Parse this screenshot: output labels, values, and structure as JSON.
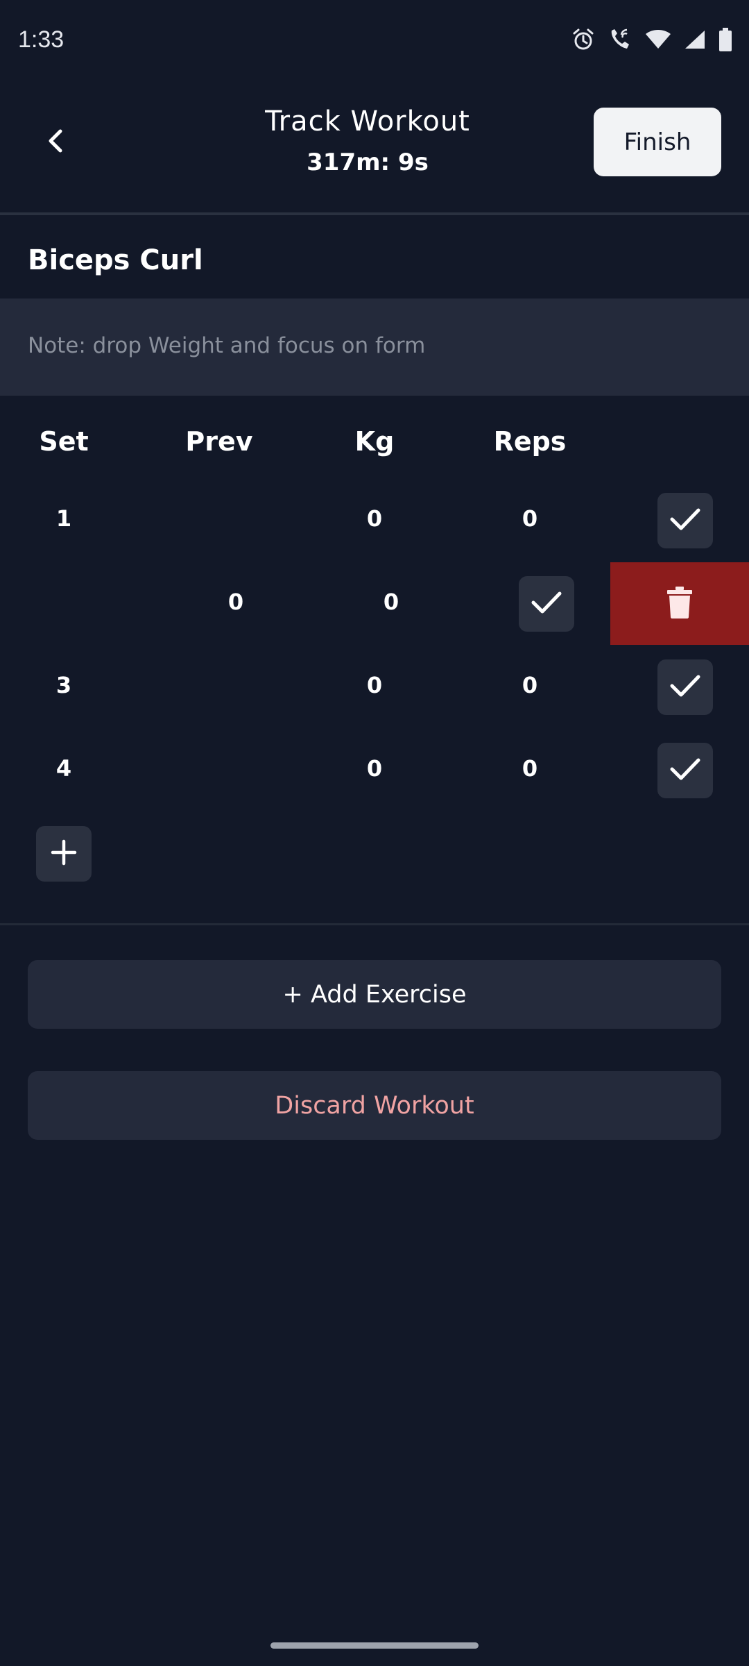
{
  "status_bar": {
    "time": "1:33",
    "icons": [
      "alarm-icon",
      "wifi-call-icon",
      "wifi-icon",
      "signal-icon",
      "battery-icon"
    ]
  },
  "header": {
    "back_icon": "chevron-left-icon",
    "title": "Track Workout",
    "timer": "317m: 9s",
    "finish_label": "Finish"
  },
  "exercise": {
    "name": "Biceps Curl",
    "note": "Note: drop Weight and focus on form"
  },
  "table": {
    "headers": [
      "Set",
      "Prev",
      "Kg",
      "Reps"
    ],
    "rows": [
      {
        "set": "1",
        "prev": "",
        "kg": "0",
        "reps": "0"
      },
      {
        "set": "",
        "prev": "",
        "kg": "0",
        "reps": "0"
      },
      {
        "set": "3",
        "prev": "",
        "kg": "0",
        "reps": "0"
      },
      {
        "set": "4",
        "prev": "",
        "kg": "0",
        "reps": "0"
      }
    ]
  },
  "actions": {
    "add_exercise_label": "+ Add Exercise",
    "discard_label": "Discard Workout"
  },
  "colors": {
    "background": "#121828",
    "surface": "#242a3b",
    "delete": "#8c1c1c",
    "discard_text": "#f0a3a3"
  }
}
